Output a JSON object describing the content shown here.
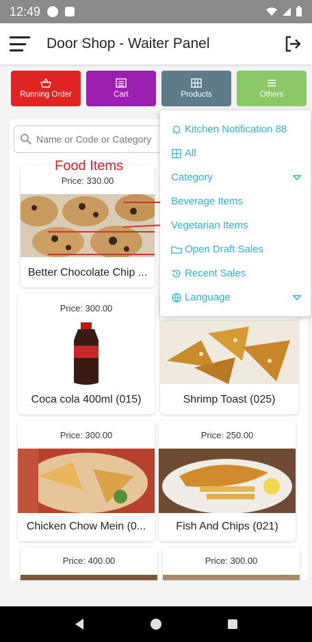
{
  "status_bar": {
    "time": "12:49"
  },
  "app_bar": {
    "title": "Door Shop - Waiter Panel"
  },
  "tabs": [
    {
      "label": "Running Order",
      "color": "#e02424",
      "icon": "basket-icon"
    },
    {
      "label": "Cart",
      "color": "#9b1fb0",
      "icon": "list-icon"
    },
    {
      "label": "Products",
      "color": "#5d7b89",
      "icon": "grid-icon"
    },
    {
      "label": "Others",
      "color": "#8bc868",
      "icon": "menu-icon"
    }
  ],
  "search": {
    "placeholder": "Name or Code or Category"
  },
  "annotation": {
    "food_items": "Food Items"
  },
  "products": [
    {
      "price": "Price: 330.00",
      "name": "Better Chocolate Chip ..."
    },
    {
      "price": "Price: 300.00",
      "name": "Coca cola 400ml (015)"
    },
    {
      "price": "",
      "name": "Shrimp Toast (025)"
    },
    {
      "price": "Price: 300.00",
      "name": "Chicken Chow Mein (0..."
    },
    {
      "price": "Price: 250.00",
      "name": "Fish And Chips (021)"
    },
    {
      "price": "Price: 400.00",
      "name": ""
    },
    {
      "price": "Price: 300.00",
      "name": ""
    }
  ],
  "dropdown": {
    "items": [
      {
        "label": "Kitchen Notification 88",
        "icon": "bell-icon"
      },
      {
        "label": "All",
        "icon": "grid-icon"
      },
      {
        "label": "Category",
        "icon": "",
        "caret": true
      },
      {
        "label": "Beverage Items",
        "icon": ""
      },
      {
        "label": "Vegetarian Items",
        "icon": ""
      },
      {
        "label": "Open Draft Sales",
        "icon": "folder-icon"
      },
      {
        "label": "Recent Sales",
        "icon": "history-icon"
      },
      {
        "label": "Language",
        "icon": "globe-icon",
        "caret": true
      }
    ]
  },
  "colors": {
    "accent": "#2bb3d6",
    "annotation": "#e01b24"
  }
}
